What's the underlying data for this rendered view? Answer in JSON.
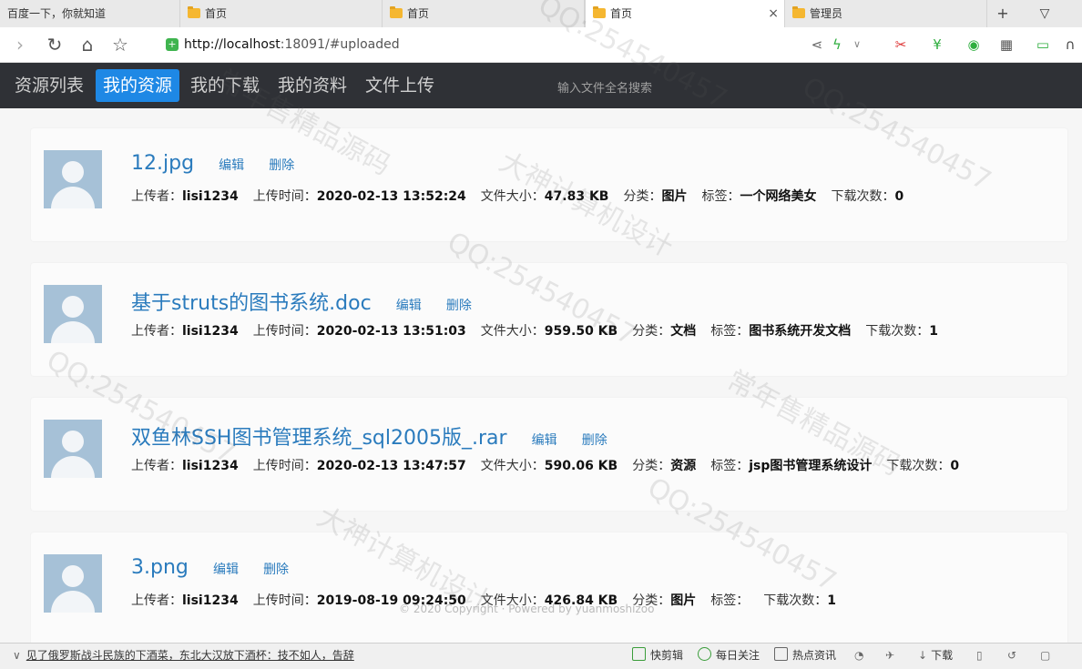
{
  "browser": {
    "tabs": [
      {
        "label": "百度一下，你就知道",
        "active": false
      },
      {
        "label": "首页",
        "active": false
      },
      {
        "label": "首页",
        "active": false
      },
      {
        "label": "首页",
        "active": true
      },
      {
        "label": "管理员",
        "active": false
      }
    ],
    "tab_close": "×",
    "new_tab": "+",
    "url_host": "http://localhost",
    "url_rest": ":18091/#uploaded"
  },
  "nav": {
    "items": [
      "资源列表",
      "我的资源",
      "我的下载",
      "我的资料",
      "文件上传"
    ],
    "active_index": 1,
    "search_placeholder": "输入文件全名搜索"
  },
  "labels": {
    "edit": "编辑",
    "delete": "删除",
    "uploader": "上传者：",
    "upload_time": "上传时间：",
    "file_size": "文件大小：",
    "category": "分类：",
    "tag": "标签：",
    "downloads": "下载次数："
  },
  "files": [
    {
      "name": "12.jpg",
      "uploader": "lisi1234",
      "time": "2020-02-13 13:52:24",
      "size": "47.83 KB",
      "category": "图片",
      "tag": "一个网络美女",
      "downloads": "0"
    },
    {
      "name": "基于struts的图书系统.doc",
      "uploader": "lisi1234",
      "time": "2020-02-13 13:51:03",
      "size": "959.50 KB",
      "category": "文档",
      "tag": "图书系统开发文档",
      "downloads": "1"
    },
    {
      "name": "双鱼林SSH图书管理系统_sql2005版_.rar",
      "uploader": "lisi1234",
      "time": "2020-02-13 13:47:57",
      "size": "590.06 KB",
      "category": "资源",
      "tag": "jsp图书管理系统设计",
      "downloads": "0"
    },
    {
      "name": "3.png",
      "uploader": "lisi1234",
      "time": "2019-08-19 09:24:50",
      "size": "426.84 KB",
      "category": "图片",
      "tag": "",
      "downloads": "1"
    }
  ],
  "footer": "© 2020 Copyright · Powered by yuanmoshizoo",
  "statusbar": {
    "news": "见了俄罗斯战斗民族的下酒菜，东北大汉放下酒杯：技不如人，告辞",
    "items": [
      "快剪辑",
      "每日关注",
      "热点资讯",
      "下载"
    ]
  },
  "watermarks": [
    "QQ:254540457",
    "大神计算机设计",
    "常年售精品源码"
  ]
}
